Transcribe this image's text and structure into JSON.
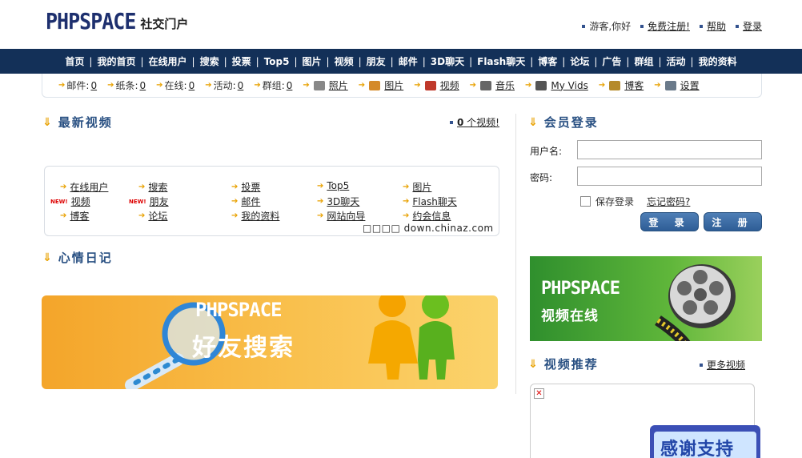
{
  "header": {
    "logo_main": "PHPSPACE",
    "logo_sub": "社交门户",
    "greeting": "游客,你好",
    "register": "免费注册!",
    "help": "帮助",
    "login": "登录"
  },
  "nav": [
    "首页",
    "我的首页",
    "在线用户",
    "搜索",
    "投票",
    "Top5",
    "图片",
    "视频",
    "朋友",
    "邮件",
    "3D聊天",
    "Flash聊天",
    "博客",
    "论坛",
    "广告",
    "群组",
    "活动",
    "我的资料"
  ],
  "subbar": {
    "stats": [
      {
        "label": "邮件:",
        "value": "0"
      },
      {
        "label": "纸条:",
        "value": "0"
      },
      {
        "label": "在线:",
        "value": "0"
      },
      {
        "label": "活动:",
        "value": "0"
      },
      {
        "label": "群组:",
        "value": "0"
      }
    ],
    "links": [
      {
        "label": "照片",
        "icon": "camera-icon",
        "color": "#888888"
      },
      {
        "label": "图片",
        "icon": "palette-icon",
        "color": "#d48a2a"
      },
      {
        "label": "视频",
        "icon": "guitar-icon",
        "color": "#c0392b"
      },
      {
        "label": "音乐",
        "icon": "disc-icon",
        "color": "#666666"
      },
      {
        "label": "My Vids",
        "icon": "video-camera-icon",
        "color": "#555555"
      },
      {
        "label": "博客",
        "icon": "notepad-icon",
        "color": "#b58a2a"
      },
      {
        "label": "设置",
        "icon": "gear-icon",
        "color": "#6a7a8a"
      }
    ]
  },
  "latest_videos": {
    "title": "最新视频",
    "count_prefix": "0",
    "count_suffix": " 个视频!"
  },
  "quick_links": [
    {
      "label": "在线用户",
      "new": false
    },
    {
      "label": "搜索",
      "new": false
    },
    {
      "label": "投票",
      "new": false
    },
    {
      "label": "Top5",
      "new": false
    },
    {
      "label": "图片",
      "new": false
    },
    {
      "label": "视频",
      "new": true
    },
    {
      "label": "朋友",
      "new": true
    },
    {
      "label": "邮件",
      "new": false
    },
    {
      "label": "3D聊天",
      "new": false
    },
    {
      "label": "Flash聊天",
      "new": false
    },
    {
      "label": "博客",
      "new": false
    },
    {
      "label": "论坛",
      "new": false
    },
    {
      "label": "我的资料",
      "new": false
    },
    {
      "label": "网站向导",
      "new": false
    },
    {
      "label": "约会信息",
      "new": false
    }
  ],
  "new_badge": "NEW!",
  "watermark": "□□□□ down.chinaz.com",
  "diary": {
    "title": "心情日记"
  },
  "friend_banner": {
    "title": "PHPSPACE",
    "subtitle": "好友搜索"
  },
  "login": {
    "title": "会员登录",
    "username_label": "用户名:",
    "password_label": "密码:",
    "remember": "保存登录",
    "forgot": "忘记密码?",
    "login_button": "登 录",
    "register_button": "注 册"
  },
  "video_banner": {
    "title": "PHPSPACE",
    "subtitle": "视频在线"
  },
  "recommended": {
    "title": "视频推荐",
    "more": "更多视频",
    "thanks": "感谢支持"
  },
  "colors": {
    "nav_bg": "#133058",
    "accent": "#2a5183",
    "arrow": "#e8a100"
  }
}
